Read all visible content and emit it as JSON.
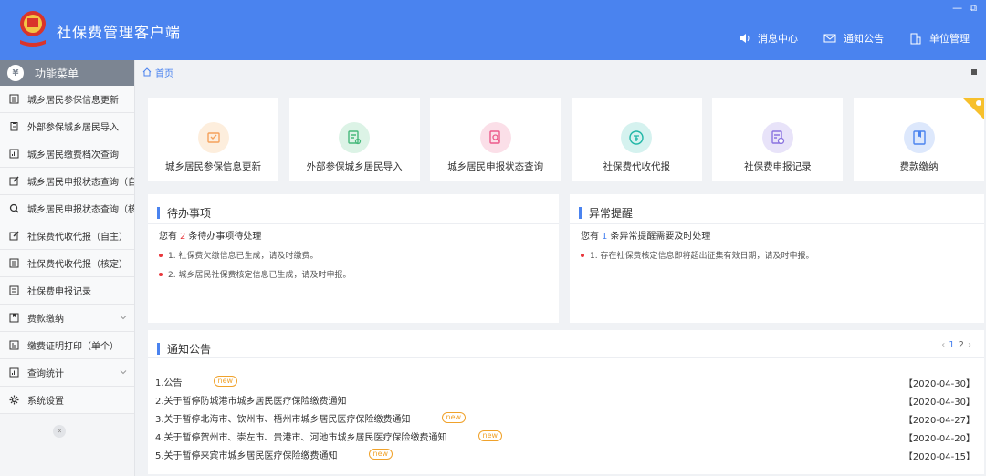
{
  "app": {
    "title": "社保费管理客户端"
  },
  "window_controls": {
    "minimize": "—",
    "restore": "⧉"
  },
  "top_nav": [
    {
      "label": "消息中心",
      "icon": "speaker-icon"
    },
    {
      "label": "通知公告",
      "icon": "mail-icon"
    },
    {
      "label": "单位管理",
      "icon": "building-icon"
    }
  ],
  "sidebar": {
    "header": "功能菜单",
    "header_icon": "¥",
    "items": [
      {
        "label": "城乡居民参保信息更新",
        "icon": "list-icon"
      },
      {
        "label": "外部参保城乡居民导入",
        "icon": "clipboard-icon"
      },
      {
        "label": "城乡居民缴费档次查询",
        "icon": "chart-icon"
      },
      {
        "label": "城乡居民申报状态查询（自主",
        "icon": "edit-icon"
      },
      {
        "label": "城乡居民申报状态查询（核定",
        "icon": "search-icon"
      },
      {
        "label": "社保费代收代报（自主）",
        "icon": "edit-icon"
      },
      {
        "label": "社保费代收代报（核定）",
        "icon": "list-icon"
      },
      {
        "label": "社保费申报记录",
        "icon": "doc-icon"
      },
      {
        "label": "费款缴纳",
        "icon": "book-icon",
        "expandable": true
      },
      {
        "label": "缴费证明打印（单个）",
        "icon": "print-icon"
      },
      {
        "label": "查询统计",
        "icon": "chart-icon",
        "expandable": true
      },
      {
        "label": "系统设置",
        "icon": "gear-icon"
      }
    ],
    "collapse": "«"
  },
  "breadcrumb": {
    "home": "首页"
  },
  "quick_cards": [
    {
      "label": "城乡居民参保信息更新",
      "color": "#f5a15b",
      "bg": "#fdeedd"
    },
    {
      "label": "外部参保城乡居民导入",
      "color": "#46b97b",
      "bg": "#dcf3e6"
    },
    {
      "label": "城乡居民申报状态查询",
      "color": "#ec5a8a",
      "bg": "#fbdfe8"
    },
    {
      "label": "社保费代收代报",
      "color": "#1fb6a6",
      "bg": "#d5f2ef"
    },
    {
      "label": "社保费申报记录",
      "color": "#8a73e0",
      "bg": "#e8e3f9"
    },
    {
      "label": "费款缴纳",
      "color": "#4a83ef",
      "bg": "#dde8fc"
    }
  ],
  "todo": {
    "title": "待办事项",
    "prefix": "您有",
    "count": "2",
    "suffix": "条待办事项待处理",
    "items": [
      "1. 社保费欠缴信息已生成，请及时缴费。",
      "2. 城乡居民社保费核定信息已生成，请及时申报。"
    ]
  },
  "alert": {
    "title": "异常提醒",
    "prefix": "您有",
    "count": "1",
    "suffix": "条异常提醒需要及时处理",
    "items": [
      "1. 存在社保费核定信息即将超出征集有效日期，请及时申报。"
    ]
  },
  "notices": {
    "title": "通知公告",
    "pager": {
      "prev": "‹",
      "page1": "1",
      "page2": "2",
      "next": "›"
    },
    "new_label": "new",
    "items": [
      {
        "title": "1.公告",
        "date": "【2020-04-30】",
        "is_new": true
      },
      {
        "title": "2.关于暂停防城港市城乡居民医疗保险缴费通知",
        "date": "【2020-04-30】",
        "is_new": false
      },
      {
        "title": "3.关于暂停北海市、钦州市、梧州市城乡居民医疗保险缴费通知",
        "date": "【2020-04-27】",
        "is_new": true
      },
      {
        "title": "4.关于暂停贺州市、崇左市、贵港市、河池市城乡居民医疗保险缴费通知",
        "date": "【2020-04-20】",
        "is_new": true
      },
      {
        "title": "5.关于暂停来宾市城乡居民医疗保险缴费通知",
        "date": "【2020-04-15】",
        "is_new": true
      }
    ]
  }
}
